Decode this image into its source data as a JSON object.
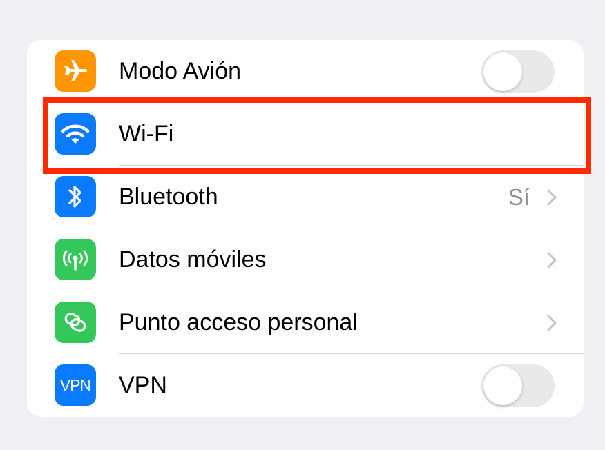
{
  "settings": {
    "rows": [
      {
        "label": "Modo Avión",
        "icon": "airplane-icon",
        "icon_color": "#ff9500",
        "control": "toggle",
        "toggle_on": false
      },
      {
        "label": "Wi-Fi",
        "icon": "wifi-icon",
        "icon_color": "#0a7aff",
        "control": "none"
      },
      {
        "label": "Bluetooth",
        "icon": "bluetooth-icon",
        "icon_color": "#0a7aff",
        "control": "chevron",
        "detail": "Sí"
      },
      {
        "label": "Datos móviles",
        "icon": "cellular-antenna-icon",
        "icon_color": "#34c759",
        "control": "chevron"
      },
      {
        "label": "Punto acceso personal",
        "icon": "personal-hotspot-icon",
        "icon_color": "#34c759",
        "control": "chevron"
      },
      {
        "label": "VPN",
        "icon": "vpn-icon",
        "icon_text": "VPN",
        "icon_color": "#0a7aff",
        "control": "toggle",
        "toggle_on": false
      }
    ]
  },
  "annotation": {
    "highlight_color": "#ff2a00",
    "highlighted_row": "Wi-Fi"
  }
}
